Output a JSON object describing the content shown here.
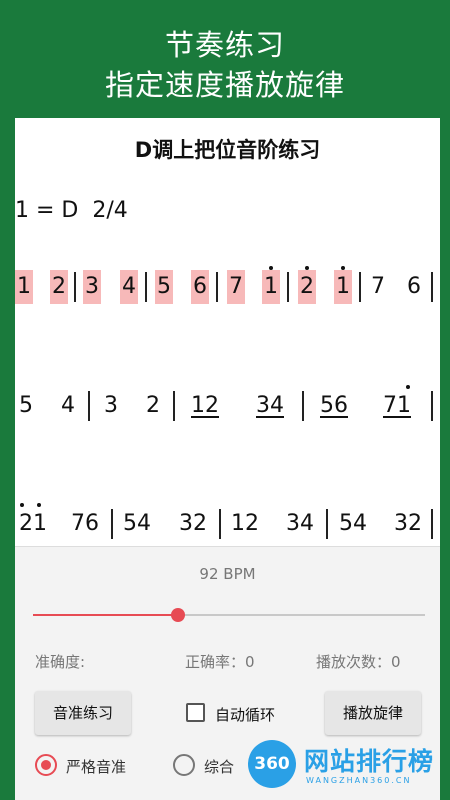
{
  "banner": {
    "line1": "节奏练习",
    "line2": "指定速度播放旋律"
  },
  "sheet": {
    "title": "D调上把位音阶练习",
    "key": "1 = D  2/4",
    "row1": [
      "1",
      "2",
      "3",
      "4",
      "5",
      "6",
      "7",
      "1",
      "2",
      "1",
      "7",
      "6"
    ],
    "row2": [
      "5",
      "4",
      "3",
      "2",
      "12",
      "34",
      "56",
      "71"
    ],
    "row3": [
      "21",
      "76",
      "54",
      "32",
      "12",
      "34",
      "54",
      "32"
    ]
  },
  "controls": {
    "bpm": "92 BPM",
    "tempo_fraction": 0.37,
    "accuracy_label": "准确度:",
    "correct_rate": "正确率：0",
    "play_count": "播放次数：0",
    "pitch_button": "音准练习",
    "auto_loop": "自动循环",
    "auto_loop_checked": false,
    "play_button": "播放旋律",
    "radio_strict": "严格音准",
    "radio_comprehensive": "综合"
  },
  "watermark": {
    "badge": "360",
    "name": "网站排行榜",
    "url": "WANGZHAN360.CN"
  }
}
